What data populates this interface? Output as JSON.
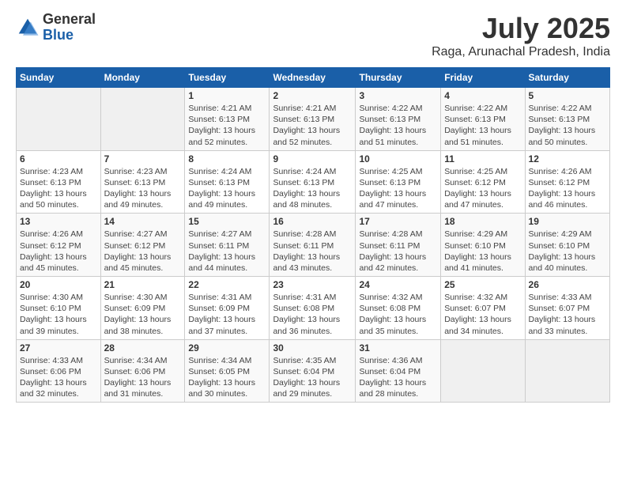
{
  "logo": {
    "general": "General",
    "blue": "Blue"
  },
  "header": {
    "month": "July 2025",
    "location": "Raga, Arunachal Pradesh, India"
  },
  "weekdays": [
    "Sunday",
    "Monday",
    "Tuesday",
    "Wednesday",
    "Thursday",
    "Friday",
    "Saturday"
  ],
  "weeks": [
    [
      {
        "day": "",
        "sunrise": "",
        "sunset": "",
        "daylight": ""
      },
      {
        "day": "",
        "sunrise": "",
        "sunset": "",
        "daylight": ""
      },
      {
        "day": "1",
        "sunrise": "Sunrise: 4:21 AM",
        "sunset": "Sunset: 6:13 PM",
        "daylight": "Daylight: 13 hours and 52 minutes."
      },
      {
        "day": "2",
        "sunrise": "Sunrise: 4:21 AM",
        "sunset": "Sunset: 6:13 PM",
        "daylight": "Daylight: 13 hours and 52 minutes."
      },
      {
        "day": "3",
        "sunrise": "Sunrise: 4:22 AM",
        "sunset": "Sunset: 6:13 PM",
        "daylight": "Daylight: 13 hours and 51 minutes."
      },
      {
        "day": "4",
        "sunrise": "Sunrise: 4:22 AM",
        "sunset": "Sunset: 6:13 PM",
        "daylight": "Daylight: 13 hours and 51 minutes."
      },
      {
        "day": "5",
        "sunrise": "Sunrise: 4:22 AM",
        "sunset": "Sunset: 6:13 PM",
        "daylight": "Daylight: 13 hours and 50 minutes."
      }
    ],
    [
      {
        "day": "6",
        "sunrise": "Sunrise: 4:23 AM",
        "sunset": "Sunset: 6:13 PM",
        "daylight": "Daylight: 13 hours and 50 minutes."
      },
      {
        "day": "7",
        "sunrise": "Sunrise: 4:23 AM",
        "sunset": "Sunset: 6:13 PM",
        "daylight": "Daylight: 13 hours and 49 minutes."
      },
      {
        "day": "8",
        "sunrise": "Sunrise: 4:24 AM",
        "sunset": "Sunset: 6:13 PM",
        "daylight": "Daylight: 13 hours and 49 minutes."
      },
      {
        "day": "9",
        "sunrise": "Sunrise: 4:24 AM",
        "sunset": "Sunset: 6:13 PM",
        "daylight": "Daylight: 13 hours and 48 minutes."
      },
      {
        "day": "10",
        "sunrise": "Sunrise: 4:25 AM",
        "sunset": "Sunset: 6:13 PM",
        "daylight": "Daylight: 13 hours and 47 minutes."
      },
      {
        "day": "11",
        "sunrise": "Sunrise: 4:25 AM",
        "sunset": "Sunset: 6:12 PM",
        "daylight": "Daylight: 13 hours and 47 minutes."
      },
      {
        "day": "12",
        "sunrise": "Sunrise: 4:26 AM",
        "sunset": "Sunset: 6:12 PM",
        "daylight": "Daylight: 13 hours and 46 minutes."
      }
    ],
    [
      {
        "day": "13",
        "sunrise": "Sunrise: 4:26 AM",
        "sunset": "Sunset: 6:12 PM",
        "daylight": "Daylight: 13 hours and 45 minutes."
      },
      {
        "day": "14",
        "sunrise": "Sunrise: 4:27 AM",
        "sunset": "Sunset: 6:12 PM",
        "daylight": "Daylight: 13 hours and 45 minutes."
      },
      {
        "day": "15",
        "sunrise": "Sunrise: 4:27 AM",
        "sunset": "Sunset: 6:11 PM",
        "daylight": "Daylight: 13 hours and 44 minutes."
      },
      {
        "day": "16",
        "sunrise": "Sunrise: 4:28 AM",
        "sunset": "Sunset: 6:11 PM",
        "daylight": "Daylight: 13 hours and 43 minutes."
      },
      {
        "day": "17",
        "sunrise": "Sunrise: 4:28 AM",
        "sunset": "Sunset: 6:11 PM",
        "daylight": "Daylight: 13 hours and 42 minutes."
      },
      {
        "day": "18",
        "sunrise": "Sunrise: 4:29 AM",
        "sunset": "Sunset: 6:10 PM",
        "daylight": "Daylight: 13 hours and 41 minutes."
      },
      {
        "day": "19",
        "sunrise": "Sunrise: 4:29 AM",
        "sunset": "Sunset: 6:10 PM",
        "daylight": "Daylight: 13 hours and 40 minutes."
      }
    ],
    [
      {
        "day": "20",
        "sunrise": "Sunrise: 4:30 AM",
        "sunset": "Sunset: 6:10 PM",
        "daylight": "Daylight: 13 hours and 39 minutes."
      },
      {
        "day": "21",
        "sunrise": "Sunrise: 4:30 AM",
        "sunset": "Sunset: 6:09 PM",
        "daylight": "Daylight: 13 hours and 38 minutes."
      },
      {
        "day": "22",
        "sunrise": "Sunrise: 4:31 AM",
        "sunset": "Sunset: 6:09 PM",
        "daylight": "Daylight: 13 hours and 37 minutes."
      },
      {
        "day": "23",
        "sunrise": "Sunrise: 4:31 AM",
        "sunset": "Sunset: 6:08 PM",
        "daylight": "Daylight: 13 hours and 36 minutes."
      },
      {
        "day": "24",
        "sunrise": "Sunrise: 4:32 AM",
        "sunset": "Sunset: 6:08 PM",
        "daylight": "Daylight: 13 hours and 35 minutes."
      },
      {
        "day": "25",
        "sunrise": "Sunrise: 4:32 AM",
        "sunset": "Sunset: 6:07 PM",
        "daylight": "Daylight: 13 hours and 34 minutes."
      },
      {
        "day": "26",
        "sunrise": "Sunrise: 4:33 AM",
        "sunset": "Sunset: 6:07 PM",
        "daylight": "Daylight: 13 hours and 33 minutes."
      }
    ],
    [
      {
        "day": "27",
        "sunrise": "Sunrise: 4:33 AM",
        "sunset": "Sunset: 6:06 PM",
        "daylight": "Daylight: 13 hours and 32 minutes."
      },
      {
        "day": "28",
        "sunrise": "Sunrise: 4:34 AM",
        "sunset": "Sunset: 6:06 PM",
        "daylight": "Daylight: 13 hours and 31 minutes."
      },
      {
        "day": "29",
        "sunrise": "Sunrise: 4:34 AM",
        "sunset": "Sunset: 6:05 PM",
        "daylight": "Daylight: 13 hours and 30 minutes."
      },
      {
        "day": "30",
        "sunrise": "Sunrise: 4:35 AM",
        "sunset": "Sunset: 6:04 PM",
        "daylight": "Daylight: 13 hours and 29 minutes."
      },
      {
        "day": "31",
        "sunrise": "Sunrise: 4:36 AM",
        "sunset": "Sunset: 6:04 PM",
        "daylight": "Daylight: 13 hours and 28 minutes."
      },
      {
        "day": "",
        "sunrise": "",
        "sunset": "",
        "daylight": ""
      },
      {
        "day": "",
        "sunrise": "",
        "sunset": "",
        "daylight": ""
      }
    ]
  ]
}
